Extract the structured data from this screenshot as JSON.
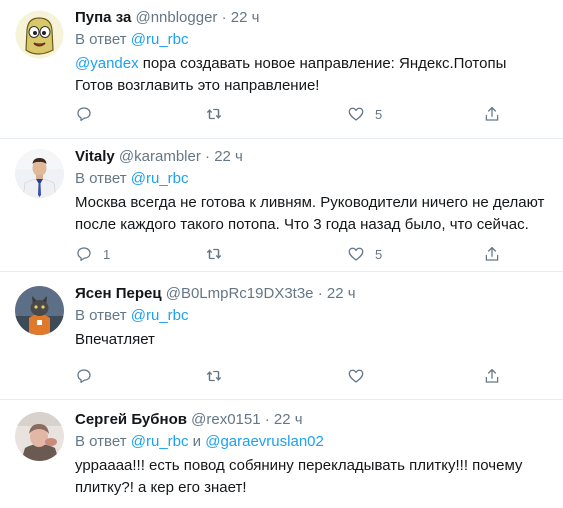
{
  "tweets": [
    {
      "name": "Пупа за",
      "handle": "@nnblogger",
      "dot": "·",
      "time": "22 ч",
      "reply_prefix": "В ответ",
      "reply_to": "@ru_rbc",
      "text_mention": "@yandex",
      "text_line1": " пора создавать новое направление: Яндекс.Потопы",
      "text_line2": "Готов возглавить это направление!",
      "reply_count": "",
      "like_count": "5"
    },
    {
      "name": "Vitaly",
      "handle": "@karambler",
      "dot": "·",
      "time": "22 ч",
      "reply_prefix": "В ответ",
      "reply_to": "@ru_rbc",
      "text_line1": "Москва всегда не готова к ливням. Руководители ничего не делают",
      "text_line2": "после каждого такого потопа. Что 3 года назад было, что сейчас.",
      "reply_count": "1",
      "like_count": "5"
    },
    {
      "name": "Ясен Перец",
      "handle": "@B0LmpRc19DX3t3e",
      "dot": "·",
      "time": "22 ч",
      "reply_prefix": "В ответ",
      "reply_to": "@ru_rbc",
      "text_line1": "Впечатляет",
      "reply_count": "",
      "like_count": ""
    },
    {
      "name": "Сергей Бубнов",
      "handle": "@rex0151",
      "dot": "·",
      "time": "22 ч",
      "reply_prefix": "В ответ",
      "reply_to": "@ru_rbc",
      "reply_and": " и ",
      "reply_to2": "@garaevruslan02",
      "text_line1": "урраааа!!! есть повод собянину перекладывать плитку!!! почему",
      "text_line2": "плитку?! а кер его знает!"
    }
  ]
}
